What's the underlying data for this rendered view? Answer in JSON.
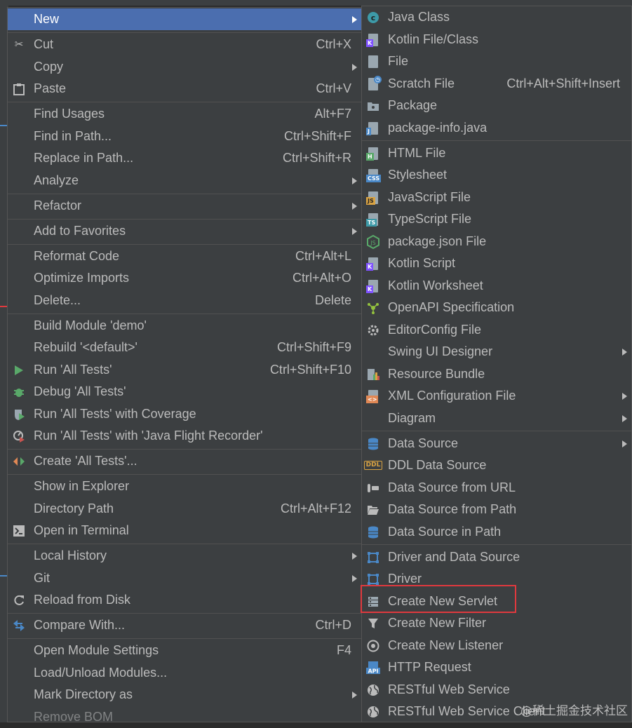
{
  "main_menu": {
    "items": [
      {
        "label": "New",
        "shortcut": "",
        "submenu": true,
        "selected": true,
        "icon": ""
      },
      {
        "label": "Cut",
        "shortcut": "Ctrl+X",
        "icon": "scissors-icon"
      },
      {
        "label": "Copy",
        "shortcut": "",
        "submenu": true,
        "icon": ""
      },
      {
        "label": "Paste",
        "shortcut": "Ctrl+V",
        "icon": "clipboard-icon"
      },
      {
        "label": "Find Usages",
        "shortcut": "Alt+F7",
        "icon": ""
      },
      {
        "label": "Find in Path...",
        "shortcut": "Ctrl+Shift+F",
        "icon": ""
      },
      {
        "label": "Replace in Path...",
        "shortcut": "Ctrl+Shift+R",
        "icon": ""
      },
      {
        "label": "Analyze",
        "shortcut": "",
        "submenu": true,
        "icon": ""
      },
      {
        "label": "Refactor",
        "shortcut": "",
        "submenu": true,
        "icon": ""
      },
      {
        "label": "Add to Favorites",
        "shortcut": "",
        "submenu": true,
        "icon": ""
      },
      {
        "label": "Reformat Code",
        "shortcut": "Ctrl+Alt+L",
        "icon": ""
      },
      {
        "label": "Optimize Imports",
        "shortcut": "Ctrl+Alt+O",
        "icon": ""
      },
      {
        "label": "Delete...",
        "shortcut": "Delete",
        "icon": ""
      },
      {
        "label": "Build Module 'demo'",
        "shortcut": "",
        "icon": ""
      },
      {
        "label": "Rebuild '<default>'",
        "shortcut": "Ctrl+Shift+F9",
        "icon": ""
      },
      {
        "label": "Run 'All Tests'",
        "shortcut": "Ctrl+Shift+F10",
        "icon": "run-icon"
      },
      {
        "label": "Debug 'All Tests'",
        "shortcut": "",
        "icon": "debug-icon"
      },
      {
        "label": "Run 'All Tests' with Coverage",
        "shortcut": "",
        "icon": "coverage-icon"
      },
      {
        "label": "Run 'All Tests' with 'Java Flight Recorder'",
        "shortcut": "",
        "icon": "profiler-icon"
      },
      {
        "label": "Create 'All Tests'...",
        "shortcut": "",
        "icon": "create-config-icon"
      },
      {
        "label": "Show in Explorer",
        "shortcut": "",
        "icon": ""
      },
      {
        "label": "Directory Path",
        "shortcut": "Ctrl+Alt+F12",
        "icon": ""
      },
      {
        "label": "Open in Terminal",
        "shortcut": "",
        "icon": "terminal-icon"
      },
      {
        "label": "Local History",
        "shortcut": "",
        "submenu": true,
        "icon": ""
      },
      {
        "label": "Git",
        "shortcut": "",
        "submenu": true,
        "icon": ""
      },
      {
        "label": "Reload from Disk",
        "shortcut": "",
        "icon": "reload-icon"
      },
      {
        "label": "Compare With...",
        "shortcut": "Ctrl+D",
        "icon": "compare-icon"
      },
      {
        "label": "Open Module Settings",
        "shortcut": "F4",
        "icon": ""
      },
      {
        "label": "Load/Unload Modules...",
        "shortcut": "",
        "icon": ""
      },
      {
        "label": "Mark Directory as",
        "shortcut": "",
        "submenu": true,
        "icon": ""
      },
      {
        "label": "Remove BOM",
        "shortcut": "",
        "icon": ""
      }
    ]
  },
  "sub_menu": {
    "items": [
      {
        "label": "Java Class",
        "shortcut": "",
        "icon": "java-class-icon"
      },
      {
        "label": "Kotlin File/Class",
        "shortcut": "",
        "icon": "kotlin-file-icon"
      },
      {
        "label": "File",
        "shortcut": "",
        "icon": "file-icon"
      },
      {
        "label": "Scratch File",
        "shortcut": "Ctrl+Alt+Shift+Insert",
        "icon": "scratch-file-icon"
      },
      {
        "label": "Package",
        "shortcut": "",
        "icon": "package-icon"
      },
      {
        "label": "package-info.java",
        "shortcut": "",
        "icon": "package-info-icon"
      },
      {
        "label": "HTML File",
        "shortcut": "",
        "icon": "html-file-icon"
      },
      {
        "label": "Stylesheet",
        "shortcut": "",
        "icon": "css-file-icon"
      },
      {
        "label": "JavaScript File",
        "shortcut": "",
        "icon": "js-file-icon"
      },
      {
        "label": "TypeScript File",
        "shortcut": "",
        "icon": "ts-file-icon"
      },
      {
        "label": "package.json File",
        "shortcut": "",
        "icon": "nodejs-icon"
      },
      {
        "label": "Kotlin Script",
        "shortcut": "",
        "icon": "kotlin-script-icon"
      },
      {
        "label": "Kotlin Worksheet",
        "shortcut": "",
        "icon": "kotlin-worksheet-icon"
      },
      {
        "label": "OpenAPI Specification",
        "shortcut": "",
        "icon": "openapi-icon"
      },
      {
        "label": "EditorConfig File",
        "shortcut": "",
        "icon": "editorconfig-icon"
      },
      {
        "label": "Swing UI Designer",
        "shortcut": "",
        "submenu": true,
        "icon": ""
      },
      {
        "label": "Resource Bundle",
        "shortcut": "",
        "icon": "resource-bundle-icon"
      },
      {
        "label": "XML Configuration File",
        "shortcut": "",
        "submenu": true,
        "icon": "xml-file-icon"
      },
      {
        "label": "Diagram",
        "shortcut": "",
        "submenu": true,
        "icon": ""
      },
      {
        "label": "Data Source",
        "shortcut": "",
        "submenu": true,
        "icon": "database-icon"
      },
      {
        "label": "DDL Data Source",
        "shortcut": "",
        "icon": "ddl-icon"
      },
      {
        "label": "Data Source from URL",
        "shortcut": "",
        "icon": "datasource-url-icon"
      },
      {
        "label": "Data Source from Path",
        "shortcut": "",
        "icon": "folder-open-icon"
      },
      {
        "label": "Data Source in Path",
        "shortcut": "",
        "icon": "database-icon"
      },
      {
        "label": "Driver and Data Source",
        "shortcut": "",
        "icon": "driver-icon"
      },
      {
        "label": "Driver",
        "shortcut": "",
        "icon": "driver-icon"
      },
      {
        "label": "Create New Servlet",
        "shortcut": "",
        "icon": "servlet-icon"
      },
      {
        "label": "Create New Filter",
        "shortcut": "",
        "icon": "filter-icon"
      },
      {
        "label": "Create New Listener",
        "shortcut": "",
        "icon": "listener-icon"
      },
      {
        "label": "HTTP Request",
        "shortcut": "",
        "icon": "api-icon"
      },
      {
        "label": "RESTful Web Service",
        "shortcut": "",
        "icon": "globe-icon"
      },
      {
        "label": "RESTful Web Service Client",
        "shortcut": "",
        "icon": "globe-icon"
      }
    ]
  },
  "watermark": "@稀土掘金技术社区",
  "colors": {
    "menu_bg": "#3c3f41",
    "selected": "#4b6eaf",
    "highlight": "#e0393e"
  }
}
